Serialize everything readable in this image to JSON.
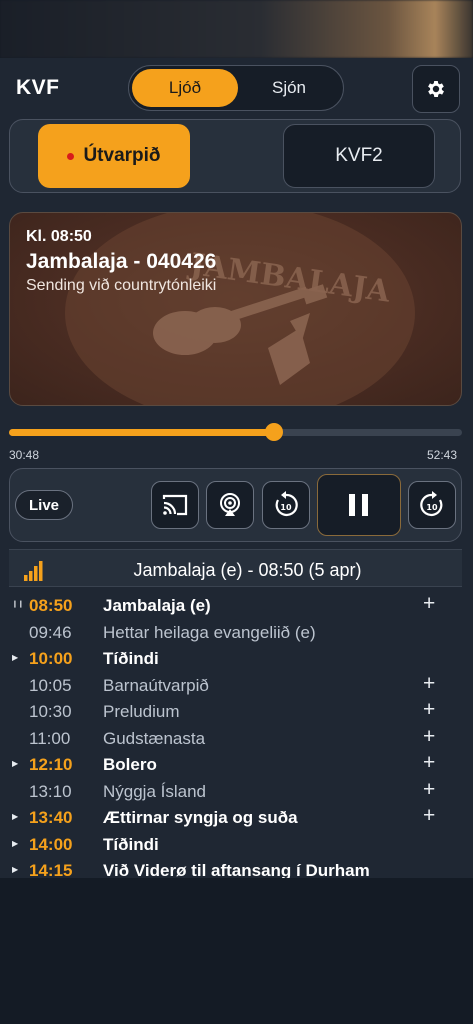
{
  "header": {
    "logo": "KVF",
    "tabs": [
      {
        "label": "Ljóð",
        "active": true
      },
      {
        "label": "Sjón",
        "active": false
      }
    ],
    "settings_icon": "gear-icon"
  },
  "channels": [
    {
      "label": "Útvarpið",
      "active": true,
      "live_dot": true
    },
    {
      "label": "KVF2",
      "active": false
    }
  ],
  "now_playing": {
    "time": "Kl. 08:50",
    "title": "Jambalaja - 040426",
    "subtitle": "Sending við countrytónleiki",
    "artwork_text": "JAMBALAJA"
  },
  "progress": {
    "elapsed": "30:48",
    "total": "52:43",
    "fraction": 0.584
  },
  "controls": {
    "live_label": "Live",
    "buttons": [
      "cast-icon",
      "airplay-icon",
      "rewind-10-icon",
      "pause-icon",
      "forward-10-icon"
    ],
    "rewind_seconds": "10",
    "forward_seconds": "10"
  },
  "now_bar": {
    "text": "Jambalaja (e) - 08:50 (5 apr)",
    "icon": "signal-bars-icon"
  },
  "schedule": [
    {
      "time": "08:50",
      "title": "Jambalaja (e)",
      "marker": "pause",
      "plus": true,
      "style": "current"
    },
    {
      "time": "09:46",
      "title": "Hettar heilaga evangeliið (e)",
      "marker": "",
      "plus": false,
      "style": "dim"
    },
    {
      "time": "10:00",
      "title": "Tíðindi",
      "marker": "play",
      "plus": false,
      "style": "bold orange"
    },
    {
      "time": "10:05",
      "title": "Barnaútvarpið",
      "marker": "",
      "plus": true,
      "style": "dim"
    },
    {
      "time": "10:30",
      "title": "Preludium",
      "marker": "",
      "plus": true,
      "style": "dim"
    },
    {
      "time": "11:00",
      "title": "Gudstænasta",
      "marker": "",
      "plus": true,
      "style": "dim"
    },
    {
      "time": "12:10",
      "title": "Bolero",
      "marker": "play",
      "plus": true,
      "style": "bold orange"
    },
    {
      "time": "13:10",
      "title": "Nýggja Ísland",
      "marker": "",
      "plus": true,
      "style": "dim"
    },
    {
      "time": "13:40",
      "title": "Ættirnar syngja og suða",
      "marker": "play",
      "plus": true,
      "style": "bold orange"
    },
    {
      "time": "14:00",
      "title": "Tíðindi",
      "marker": "play",
      "plus": false,
      "style": "bold orange"
    },
    {
      "time": "14:15",
      "title": "Við Viderø til aftansang í Durham",
      "marker": "play",
      "plus": false,
      "style": "bold orange"
    }
  ],
  "colors": {
    "accent": "#f5a11c",
    "background": "#1f2733",
    "live_dot": "#d81b1b"
  }
}
